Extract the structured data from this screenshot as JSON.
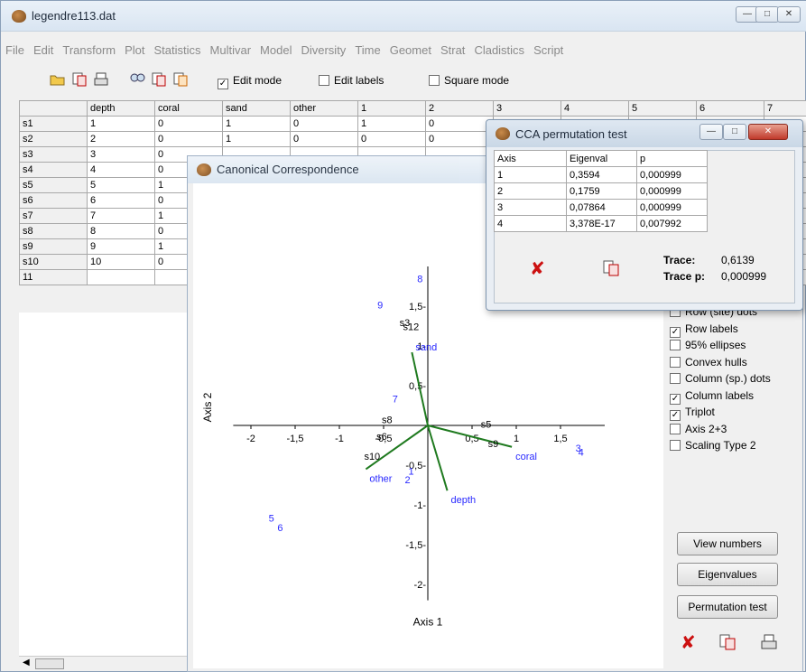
{
  "main": {
    "title": "legendre113.dat",
    "menu": [
      "File",
      "Edit",
      "Transform",
      "Plot",
      "Statistics",
      "Multivar",
      "Model",
      "Diversity",
      "Time",
      "Geomet",
      "Strat",
      "Cladistics",
      "Script"
    ],
    "edit_mode_label": "Edit mode",
    "edit_labels_label": "Edit labels",
    "square_mode_label": "Square mode",
    "edit_mode_checked": true,
    "grid_headers": [
      "depth",
      "coral",
      "sand",
      "other",
      "1",
      "2",
      "3",
      "4",
      "5",
      "6",
      "7"
    ],
    "grid_rows": [
      {
        "label": "s1",
        "cells": [
          "1",
          "0",
          "1",
          "0",
          "1",
          "0"
        ]
      },
      {
        "label": "s2",
        "cells": [
          "2",
          "0",
          "1",
          "0",
          "0",
          "0"
        ]
      },
      {
        "label": "s3",
        "cells": [
          "3",
          "0"
        ]
      },
      {
        "label": "s4",
        "cells": [
          "4",
          "0"
        ]
      },
      {
        "label": "s5",
        "cells": [
          "5",
          "1"
        ]
      },
      {
        "label": "s6",
        "cells": [
          "6",
          "0"
        ]
      },
      {
        "label": "s7",
        "cells": [
          "7",
          "1"
        ]
      },
      {
        "label": "s8",
        "cells": [
          "8",
          "0"
        ]
      },
      {
        "label": "s9",
        "cells": [
          "9",
          "1"
        ]
      },
      {
        "label": "s10",
        "cells": [
          "10",
          "0"
        ]
      },
      {
        "label": "11",
        "cells": []
      }
    ]
  },
  "cca": {
    "title": "Canonical Correspondence",
    "xlabel": "Axis 1",
    "ylabel": "Axis 2",
    "options": [
      {
        "label": "Row (site) dots",
        "checked": false
      },
      {
        "label": "Row labels",
        "checked": true
      },
      {
        "label": "95% ellipses",
        "checked": false
      },
      {
        "label": "Convex hulls",
        "checked": false
      },
      {
        "label": "Column (sp.) dots",
        "checked": false
      },
      {
        "label": "Column labels",
        "checked": true
      },
      {
        "label": "Triplot",
        "checked": true
      },
      {
        "label": "Axis 2+3",
        "checked": false
      },
      {
        "label": "Scaling Type 2",
        "checked": false
      }
    ],
    "buttons": {
      "view_numbers": "View numbers",
      "eigenvalues": "Eigenvalues",
      "permutation_test": "Permutation test"
    }
  },
  "perm": {
    "title": "CCA permutation test",
    "headers": [
      "Axis",
      "Eigenval",
      "p"
    ],
    "rows": [
      [
        "1",
        "0,3594",
        "0,000999"
      ],
      [
        "2",
        "0,1759",
        "0,000999"
      ],
      [
        "3",
        "0,07864",
        "0,000999"
      ],
      [
        "4",
        "3,378E-17",
        "0,007992"
      ]
    ],
    "trace_label": "Trace:",
    "trace_value": "0,6139",
    "trace_p_label": "Trace p:",
    "trace_p_value": "0,000999"
  },
  "colors": {
    "label_blue": "#2a2aff",
    "vector_green": "#1f7a1f",
    "close_red": "#cc1010"
  },
  "chart_data": {
    "type": "scatter",
    "xlabel": "Axis 1",
    "ylabel": "Axis 2",
    "xticks": [
      -2,
      -1.5,
      -1,
      -0.5,
      0.5,
      1,
      1.5
    ],
    "xtick_labels": [
      "-2",
      "-1,5",
      "-1",
      "-0,5",
      "0,5",
      "1",
      "1,5"
    ],
    "yticks": [
      -2,
      -1.5,
      -1,
      -0.5,
      0.5,
      1,
      1.5
    ],
    "ytick_labels": [
      "-2-",
      "-1,5-",
      "-1-",
      "-0,5-",
      "0,5-",
      "1-",
      "1,5-"
    ],
    "xlim": [
      -2.2,
      2.0
    ],
    "ylim": [
      -2.2,
      2.0
    ],
    "vectors": [
      {
        "name": "sand",
        "x": -0.18,
        "y": 0.92
      },
      {
        "name": "coral",
        "x": 0.95,
        "y": -0.27
      },
      {
        "name": "depth",
        "x": 0.22,
        "y": -0.82
      },
      {
        "name": "other",
        "x": -0.7,
        "y": -0.55
      }
    ],
    "site_labels": [
      {
        "text": "s3",
        "x": -0.32,
        "y": 1.25
      },
      {
        "text": "s12",
        "x": -0.28,
        "y": 1.2
      },
      {
        "text": "s8",
        "x": -0.52,
        "y": 0.03
      },
      {
        "text": "s6",
        "x": -0.58,
        "y": -0.18
      },
      {
        "text": "s10",
        "x": -0.72,
        "y": -0.43
      },
      {
        "text": "s5",
        "x": 0.6,
        "y": -0.03
      },
      {
        "text": "s9",
        "x": 0.68,
        "y": -0.27
      }
    ],
    "species_labels": [
      {
        "text": "8",
        "x": -0.12,
        "y": 1.8
      },
      {
        "text": "9",
        "x": -0.57,
        "y": 1.47
      },
      {
        "text": "7",
        "x": -0.4,
        "y": 0.29
      },
      {
        "text": "1",
        "x": -0.22,
        "y": -0.62
      },
      {
        "text": "2",
        "x": -0.26,
        "y": -0.73
      },
      {
        "text": "3",
        "x": 1.67,
        "y": -0.33
      },
      {
        "text": "4",
        "x": 1.7,
        "y": -0.38
      },
      {
        "text": "5",
        "x": -1.8,
        "y": -1.21
      },
      {
        "text": "6",
        "x": -1.7,
        "y": -1.33
      }
    ]
  }
}
